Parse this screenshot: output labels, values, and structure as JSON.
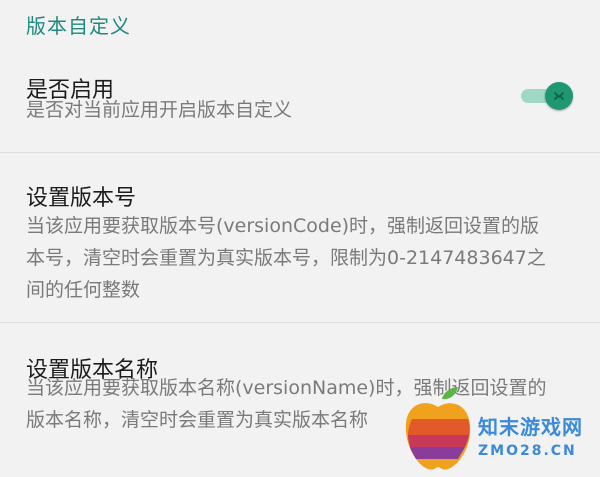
{
  "section": {
    "title": "版本自定义"
  },
  "enable": {
    "title": "是否启用",
    "summary": "是否对当前应用开启版本自定义",
    "switch_on": true
  },
  "version_code": {
    "title": "设置版本号",
    "summary": "当该应用要获取版本号(versionCode)时，强制返回设置的版本号，清空时会重置为真实版本号，限制为0-2147483647之间的任何整数"
  },
  "version_name": {
    "title": "设置版本名称",
    "summary": "当该应用要获取版本名称(versionName)时，强制返回设置的版本名称，清空时会重置为真实版本名称"
  },
  "watermark": {
    "line1": "知末游戏网",
    "line2": "ZMO28.CN"
  },
  "colors": {
    "accent": "#1e8a7e",
    "switch_thumb": "#1f9770",
    "switch_track": "#9fd9c6",
    "background": "#f2f2f2"
  }
}
